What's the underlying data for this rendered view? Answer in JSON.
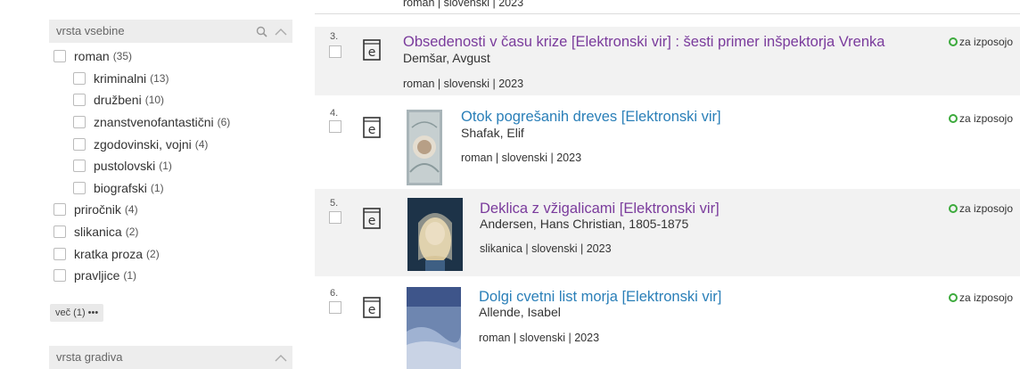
{
  "sidebar": {
    "facet1": {
      "title": "vrsta vsebine"
    },
    "items": [
      {
        "label": "roman",
        "count": "(35)"
      },
      {
        "label": "kriminalni",
        "count": "(13)"
      },
      {
        "label": "družbeni",
        "count": "(10)"
      },
      {
        "label": "znanstvenofantastični",
        "count": "(6)"
      },
      {
        "label": "zgodovinski, vojni",
        "count": "(4)"
      },
      {
        "label": "pustolovski",
        "count": "(1)"
      },
      {
        "label": "biografski",
        "count": "(1)"
      },
      {
        "label": "priročnik",
        "count": "(4)"
      },
      {
        "label": "slikanica",
        "count": "(2)"
      },
      {
        "label": "kratka proza",
        "count": "(2)"
      },
      {
        "label": "pravljice",
        "count": "(1)"
      }
    ],
    "more_label": "več (1) •••",
    "facet2": {
      "title": "vrsta gradiva"
    }
  },
  "results": {
    "top_meta": "roman | slovenski | 2023",
    "items": [
      {
        "num": "3.",
        "title": "Obsedenosti v času krize [Elektronski vir] : šesti primer inšpektorja Vrenka",
        "author": "Demšar, Avgust",
        "meta": "roman | slovenski | 2023",
        "availability": "za izposojo"
      },
      {
        "num": "4.",
        "title": "Otok pogrešanih dreves [Elektronski vir]",
        "author": "Shafak, Elif",
        "meta": "roman | slovenski | 2023",
        "availability": "za izposojo"
      },
      {
        "num": "5.",
        "title": "Deklica z vžigalicami [Elektronski vir]",
        "author": "Andersen, Hans Christian, 1805-1875",
        "meta": "slikanica | slovenski | 2023",
        "availability": "za izposojo"
      },
      {
        "num": "6.",
        "title": "Dolgi cvetni list morja [Elektronski vir]",
        "author": "Allende, Isabel",
        "meta": "roman | slovenski | 2023",
        "availability": "za izposojo"
      }
    ]
  },
  "colors": {
    "title_visited": "#7a3b9c",
    "title_link": "#2a7fb8",
    "available": "#3caa3c"
  },
  "icons": {
    "search": "search-icon",
    "collapse": "chevron-up-icon",
    "format": "ebook-e-icon"
  }
}
